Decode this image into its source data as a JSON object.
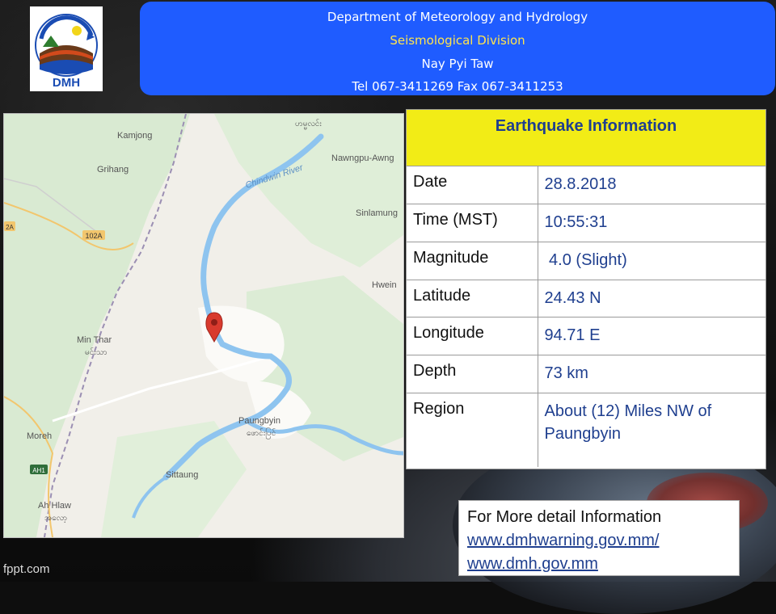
{
  "header": {
    "line1": "Department of Meteorology and Hydrology",
    "line2": "Seismological Division",
    "line3": "Nay Pyi Taw",
    "line4": "Tel 067-3411269 Fax 067-3411253"
  },
  "logo": {
    "text": "DMH"
  },
  "map": {
    "places": {
      "kamjong": "Kamjong",
      "grihang": "Grihang",
      "mangli": "ဟမ္မလင်း",
      "nawngpu": "Nawngpu-Awng",
      "sinlamung": "Sinlamung",
      "hwein": "Hwein",
      "minthar": "Min Thar",
      "minthar_mm": "မင်းသာ",
      "paungbyin": "Paungbyin",
      "paungbyin_mm": "ဖောင်းပြင်",
      "moreh": "Moreh",
      "sittaung": "Sittaung",
      "ahhlaw": "Ah Hlaw",
      "ahhlaw_mm": "အလော့",
      "river": "Chindwin River"
    },
    "roads": {
      "r102a": "102A",
      "r2a": "2A",
      "ah1": "AH1"
    }
  },
  "info": {
    "title": "Earthquake Information",
    "rows": [
      {
        "label": "Date",
        "value": "28.8.2018"
      },
      {
        "label": "Time (MST)",
        "value": "10:55:31"
      },
      {
        "label": "Magnitude",
        "value": " 4.0 (Slight)"
      },
      {
        "label": "Latitude",
        "value": "24.43 N"
      },
      {
        "label": "Longitude",
        "value": "94.71 E"
      },
      {
        "label": "Depth",
        "value": "73 km"
      },
      {
        "label": "Region",
        "value": "About (12) Miles NW of Paungbyin"
      }
    ]
  },
  "more": {
    "title": "For More detail Information",
    "link1": "www.dmhwarning.gov.mm/",
    "link2": "www.dmh.gov.mm"
  },
  "footer": {
    "brand": "fppt.com"
  }
}
